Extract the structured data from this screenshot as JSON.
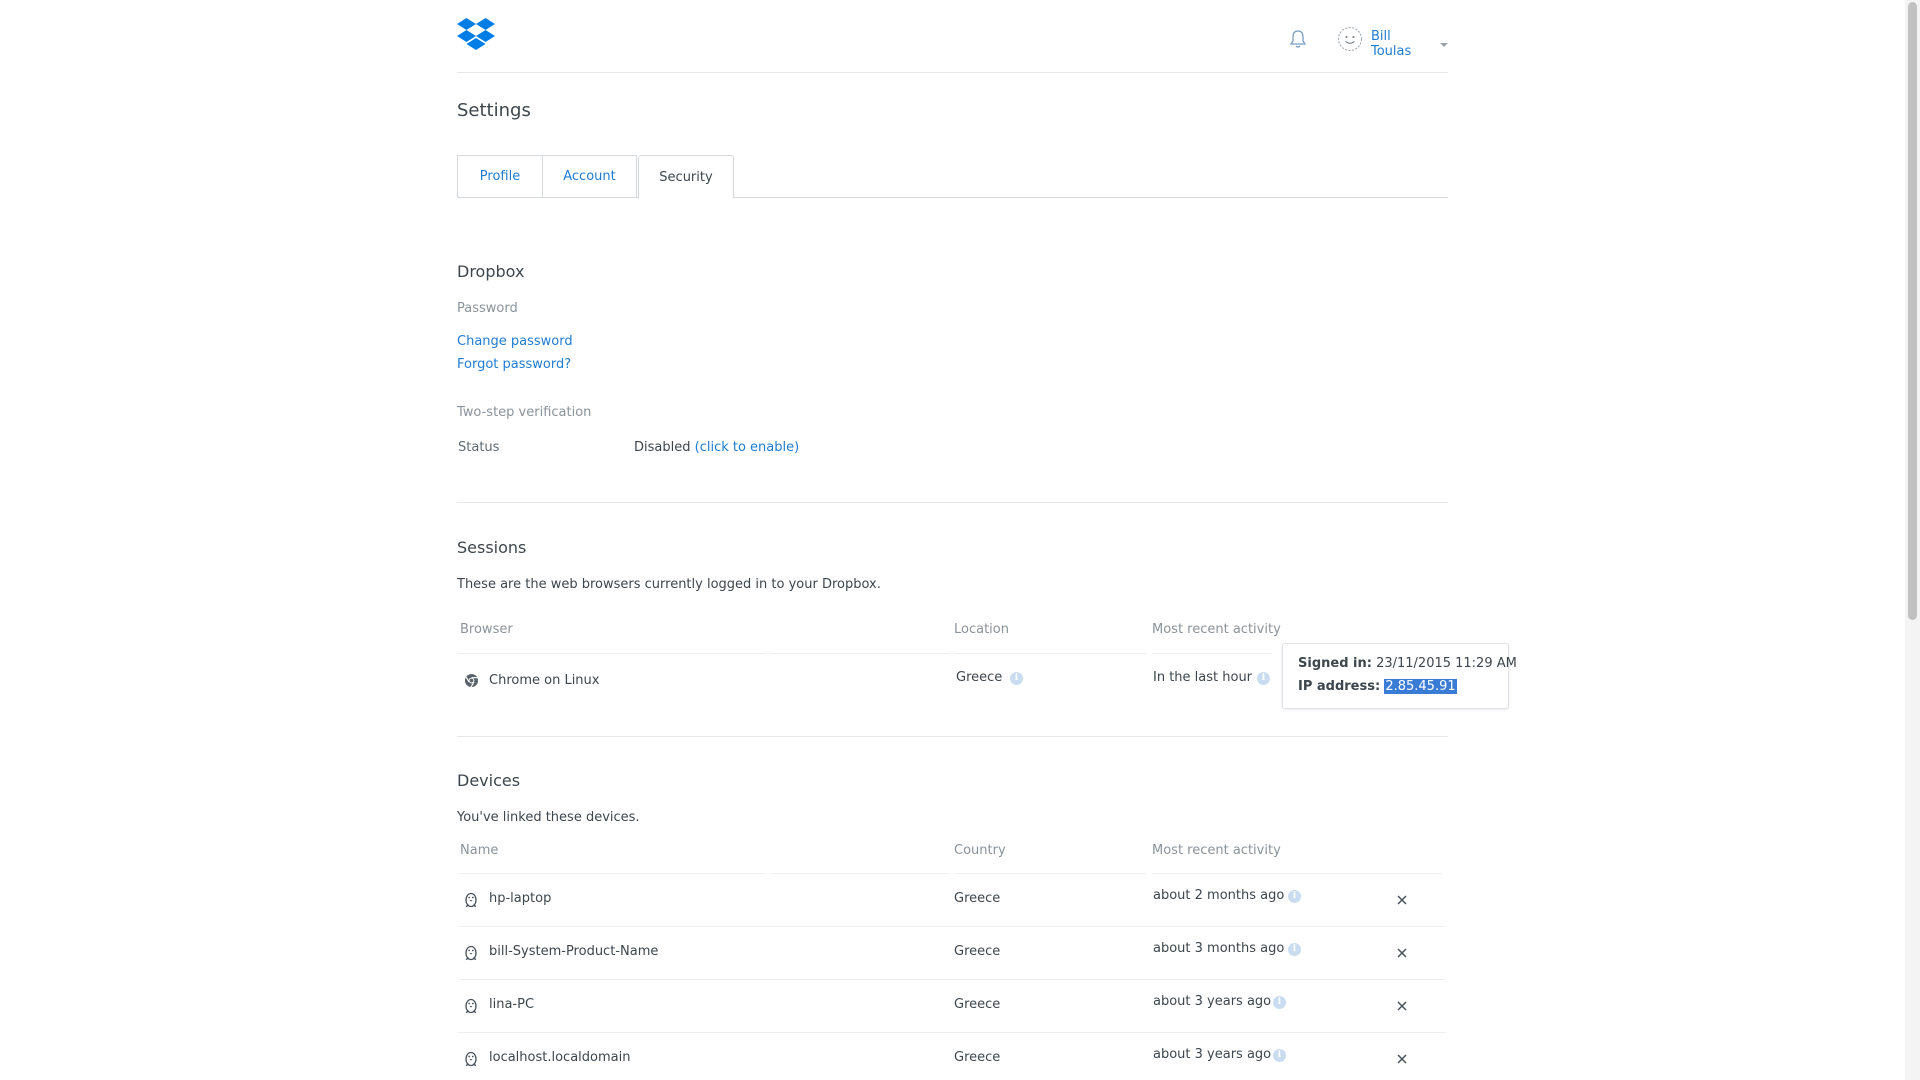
{
  "header": {
    "logo": "dropbox-logo",
    "notifications_icon": "bell-icon",
    "user_avatar_icon": "smiley-avatar-icon",
    "user_name": "Bill Toulas"
  },
  "page": {
    "title": "Settings"
  },
  "tabs": [
    {
      "label": "Profile",
      "active": false
    },
    {
      "label": "Account",
      "active": false
    },
    {
      "label": "Security",
      "active": true
    }
  ],
  "dropbox_section": {
    "heading": "Dropbox",
    "password_label": "Password",
    "change_password": "Change password",
    "forgot_password": "Forgot password?",
    "two_step_label": "Two-step verification",
    "status_label": "Status",
    "status_value": "Disabled",
    "status_enable_link": "(click to enable)"
  },
  "sessions": {
    "heading": "Sessions",
    "description": "These are the web browsers currently logged in to your Dropbox.",
    "columns": [
      "Browser",
      "Location",
      "Most recent activity"
    ],
    "rows": [
      {
        "icon": "chrome-icon",
        "browser": "Chrome on Linux",
        "location": "Greece",
        "activity": "In the last hour"
      }
    ],
    "tooltip": {
      "signed_in_label": "Signed in:",
      "signed_in_value": "23/11/2015 11:29 AM",
      "ip_label": "IP address:",
      "ip_value": "2.85.45.91"
    }
  },
  "devices": {
    "heading": "Devices",
    "description": "You've linked these devices.",
    "columns": [
      "Name",
      "Country",
      "Most recent activity"
    ],
    "rows": [
      {
        "icon": "linux-tux-icon",
        "name": "hp-laptop",
        "country": "Greece",
        "activity": "about 2 months ago"
      },
      {
        "icon": "linux-tux-icon",
        "name": "bill-System-Product-Name",
        "country": "Greece",
        "activity": "about 3 months ago"
      },
      {
        "icon": "linux-tux-icon",
        "name": "lina-PC",
        "country": "Greece",
        "activity": "about 3 years ago"
      },
      {
        "icon": "linux-tux-icon",
        "name": "localhost.localdomain",
        "country": "Greece",
        "activity": "about 3 years ago"
      }
    ]
  },
  "colors": {
    "link": "#1f7cd3",
    "text": "#3d464d",
    "muted": "#8a939b",
    "dropbox_blue": "#007ee5",
    "selection": "#3a7bd5"
  }
}
